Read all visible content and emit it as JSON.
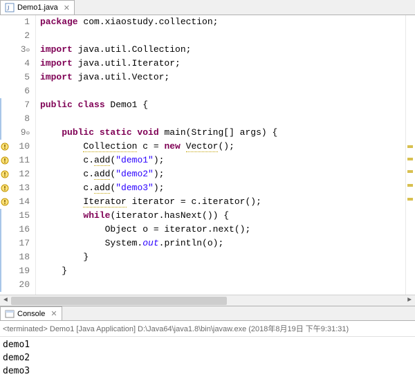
{
  "editorTab": {
    "filename": "Demo1.java"
  },
  "code": {
    "lines": [
      {
        "n": "1",
        "marker": "",
        "fold": "",
        "tokens": [
          [
            "kw",
            "package"
          ],
          [
            "",
            " com.xiaostudy.collection;"
          ]
        ]
      },
      {
        "n": "2",
        "marker": "",
        "fold": "",
        "tokens": [
          [
            "",
            ""
          ]
        ]
      },
      {
        "n": "3",
        "marker": "",
        "fold": "⊖",
        "tokens": [
          [
            "kw",
            "import"
          ],
          [
            "",
            " java.util.Collection;"
          ]
        ]
      },
      {
        "n": "4",
        "marker": "",
        "fold": "",
        "tokens": [
          [
            "kw",
            "import"
          ],
          [
            "",
            " java.util.Iterator;"
          ]
        ]
      },
      {
        "n": "5",
        "marker": "",
        "fold": "",
        "tokens": [
          [
            "kw",
            "import"
          ],
          [
            "",
            " java.util.Vector;"
          ]
        ]
      },
      {
        "n": "6",
        "marker": "",
        "fold": "",
        "tokens": [
          [
            "",
            ""
          ]
        ]
      },
      {
        "n": "7",
        "marker": "hl",
        "fold": "",
        "tokens": [
          [
            "kw",
            "public class"
          ],
          [
            "",
            " Demo1 {"
          ]
        ]
      },
      {
        "n": "8",
        "marker": "hl",
        "fold": "",
        "tokens": [
          [
            "",
            ""
          ]
        ]
      },
      {
        "n": "9",
        "marker": "hl",
        "fold": "⊖",
        "tokens": [
          [
            "",
            "    "
          ],
          [
            "kw",
            "public static void"
          ],
          [
            "",
            " main(String[] args) {"
          ]
        ]
      },
      {
        "n": "10",
        "marker": "warn",
        "fold": "",
        "tokens": [
          [
            "",
            "        "
          ],
          [
            "warn",
            "Collection"
          ],
          [
            "",
            " c = "
          ],
          [
            "kw",
            "new"
          ],
          [
            "",
            " "
          ],
          [
            "warn",
            "Vector"
          ],
          [
            "",
            "();"
          ]
        ]
      },
      {
        "n": "11",
        "marker": "warn",
        "fold": "",
        "tokens": [
          [
            "",
            "        c."
          ],
          [
            "warn",
            "add"
          ],
          [
            "",
            "("
          ],
          [
            "str",
            "\"demo1\""
          ],
          [
            "",
            ");"
          ]
        ]
      },
      {
        "n": "12",
        "marker": "warn",
        "fold": "",
        "tokens": [
          [
            "",
            "        c."
          ],
          [
            "warn",
            "add"
          ],
          [
            "",
            "("
          ],
          [
            "str",
            "\"demo2\""
          ],
          [
            "",
            ");"
          ]
        ]
      },
      {
        "n": "13",
        "marker": "warn",
        "fold": "",
        "tokens": [
          [
            "",
            "        c."
          ],
          [
            "warn",
            "add"
          ],
          [
            "",
            "("
          ],
          [
            "str",
            "\"demo3\""
          ],
          [
            "",
            ");"
          ]
        ]
      },
      {
        "n": "14",
        "marker": "warn",
        "fold": "",
        "tokens": [
          [
            "",
            "        "
          ],
          [
            "warn",
            "Iterator"
          ],
          [
            "",
            " iterator = c.iterator();"
          ]
        ]
      },
      {
        "n": "15",
        "marker": "hl",
        "fold": "",
        "tokens": [
          [
            "",
            "        "
          ],
          [
            "kw",
            "while"
          ],
          [
            "",
            "(iterator.hasNext()) {"
          ]
        ]
      },
      {
        "n": "16",
        "marker": "hl",
        "fold": "",
        "tokens": [
          [
            "",
            "            Object o = iterator.next();"
          ]
        ]
      },
      {
        "n": "17",
        "marker": "hl",
        "fold": "",
        "tokens": [
          [
            "",
            "            System."
          ],
          [
            "static",
            "out"
          ],
          [
            "",
            ".println(o);"
          ]
        ]
      },
      {
        "n": "18",
        "marker": "hl",
        "fold": "",
        "tokens": [
          [
            "",
            "        }"
          ]
        ]
      },
      {
        "n": "19",
        "marker": "hl",
        "fold": "",
        "tokens": [
          [
            "",
            "    }"
          ]
        ]
      },
      {
        "n": "20",
        "marker": "hl",
        "fold": "",
        "tokens": [
          [
            "",
            ""
          ]
        ]
      }
    ]
  },
  "consoleTab": {
    "label": "Console"
  },
  "console": {
    "header": "<terminated> Demo1 [Java Application] D:\\Java64\\java1.8\\bin\\javaw.exe (2018年8月19日 下午9:31:31)",
    "output": [
      "demo1",
      "demo2",
      "demo3"
    ]
  }
}
